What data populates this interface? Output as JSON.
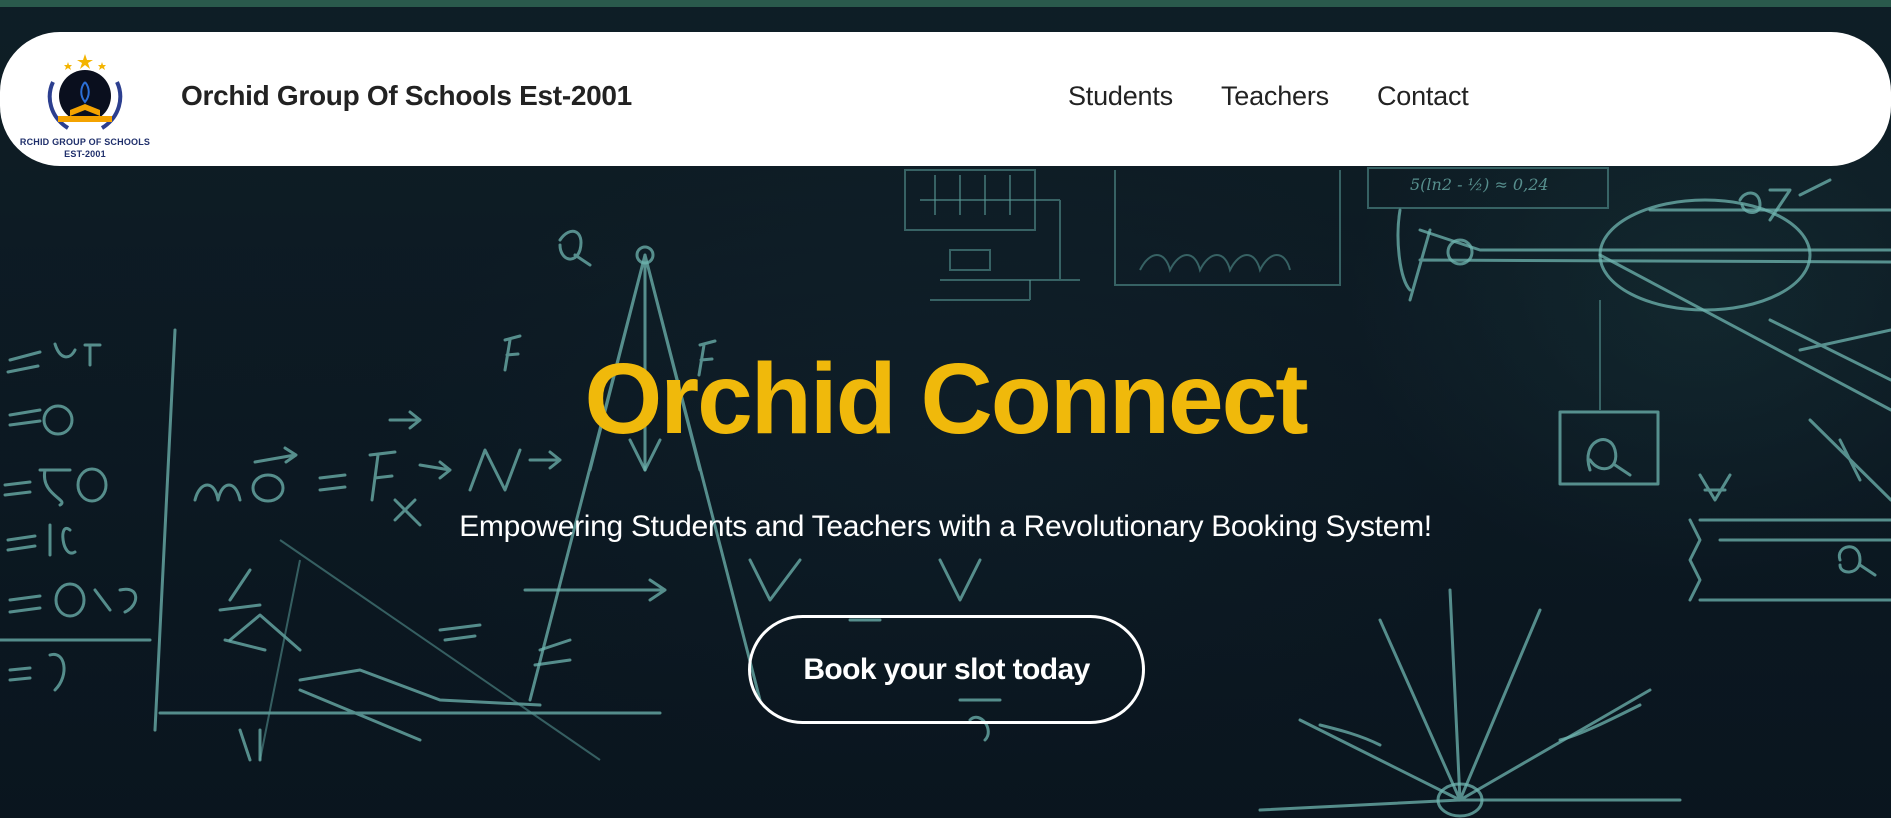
{
  "header": {
    "logo_caption_line1": "RCHID GROUP OF SCHOOLS",
    "logo_caption_line2": "EST-2001",
    "brand_name": "Orchid Group Of Schools Est-2001"
  },
  "nav": {
    "items": [
      {
        "label": "Students"
      },
      {
        "label": "Teachers"
      },
      {
        "label": "Contact"
      }
    ]
  },
  "hero": {
    "title": "Orchid Connect",
    "subtitle": "Empowering Students and Teachers with a Revolutionary Booking System!",
    "cta_label": "Book your slot today"
  },
  "colors": {
    "accent": "#f0b90b",
    "background": "#0f1f29",
    "chalk": "#6fb5b0",
    "logo_navy": "#1f2f6b"
  }
}
